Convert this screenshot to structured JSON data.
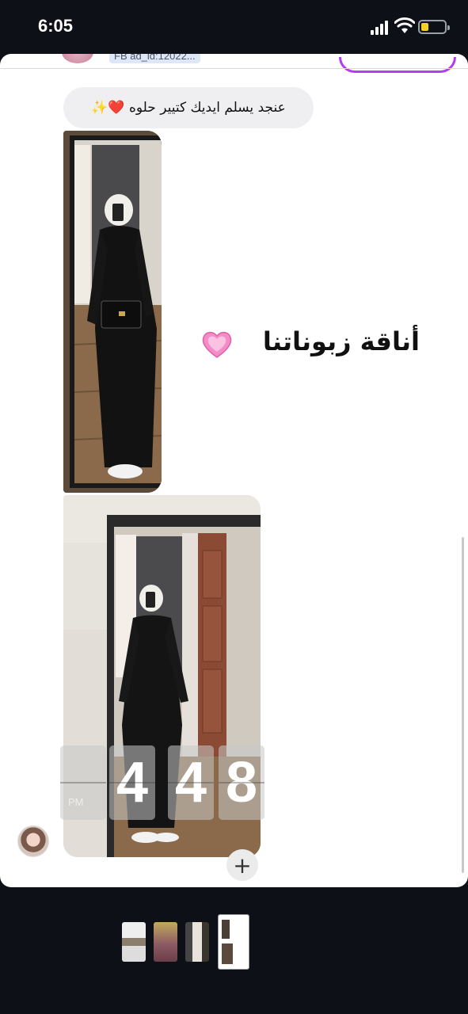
{
  "status_bar": {
    "time": "6:05",
    "battery_color": "#f5d020"
  },
  "story": {
    "ad_label": "FB ad_id:12022...",
    "reply_message": "عنجد يسلم ايديك كتيير حلوه ❤️✨",
    "caption": "أناقة زبوناتنا",
    "caption_emoji": "heart-sparkle",
    "clock": {
      "digits": [
        "4",
        "4",
        "8"
      ],
      "period": "PM"
    },
    "add_label": "+",
    "accent_color": "#b43cf0"
  },
  "thumbnails": [
    {
      "id": 1,
      "selected": false
    },
    {
      "id": 2,
      "selected": false
    },
    {
      "id": 3,
      "selected": false
    },
    {
      "id": 4,
      "selected": true
    }
  ]
}
